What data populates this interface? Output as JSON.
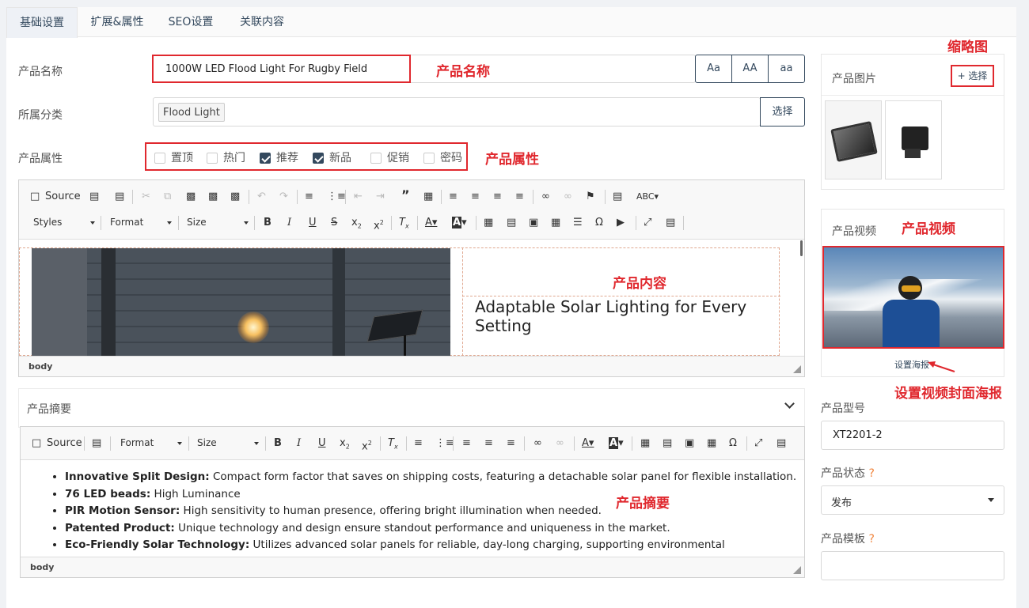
{
  "tabs": [
    "基础设置",
    "扩展&属性",
    "SEO设置",
    "关联内容"
  ],
  "form": {
    "name_label": "产品名称",
    "name_value": "1000W LED Flood Light For Rugby Field",
    "case_buttons": [
      "Aa",
      "AA",
      "aa"
    ],
    "category_label": "所属分类",
    "category_tag": "Flood Light",
    "category_button": "选择",
    "attr_label": "产品属性",
    "attributes": [
      {
        "label": "置顶",
        "checked": false
      },
      {
        "label": "热门",
        "checked": false
      },
      {
        "label": "推荐",
        "checked": true
      },
      {
        "label": "新品",
        "checked": true
      },
      {
        "label": "促销",
        "checked": false
      },
      {
        "label": "密码",
        "checked": false
      }
    ]
  },
  "annotations": {
    "name": "产品名称",
    "attributes": "产品属性",
    "content": "产品内容",
    "summary": "产品摘要",
    "thumb": "缩略图",
    "video": "产品视频",
    "poster": "设置视频封面海报"
  },
  "content_editor": {
    "source_label": "Source",
    "styles_label": "Styles",
    "format_label": "Format",
    "size_label": "Size",
    "heading": "Adaptable Solar Lighting for Every Setting",
    "status": "body"
  },
  "summary": {
    "title": "产品摘要",
    "source_label": "Source",
    "format_label": "Format",
    "size_label": "Size",
    "status": "body",
    "bullets": [
      {
        "bold": "Innovative Split Design:",
        "text": " Compact form factor that saves on shipping costs, featuring a detachable solar panel for flexible installation."
      },
      {
        "bold": "76 LED beads:",
        "text": " High Luminance"
      },
      {
        "bold": "PIR Motion Sensor:",
        "text": " High sensitivity to human presence, offering bright illumination when needed."
      },
      {
        "bold": "Patented Product:",
        "text": " Unique technology and design ensure standout performance and uniqueness in the market."
      },
      {
        "bold": "Eco-Friendly Solar Technology:",
        "text": " Utilizes advanced solar panels for reliable, day-long charging, supporting environmental sustainability."
      }
    ]
  },
  "sidebar": {
    "image_title": "产品图片",
    "select_button": "+ 选择",
    "video_title": "产品视频",
    "poster_link": "设置海报",
    "model_label": "产品型号",
    "model_value": "XT2201-2",
    "status_label": "产品状态",
    "status_value": "发布",
    "template_label": "产品模板",
    "help_mark": "?"
  },
  "colors": {
    "accent": "#34495e",
    "annotation": "#e0282e"
  }
}
